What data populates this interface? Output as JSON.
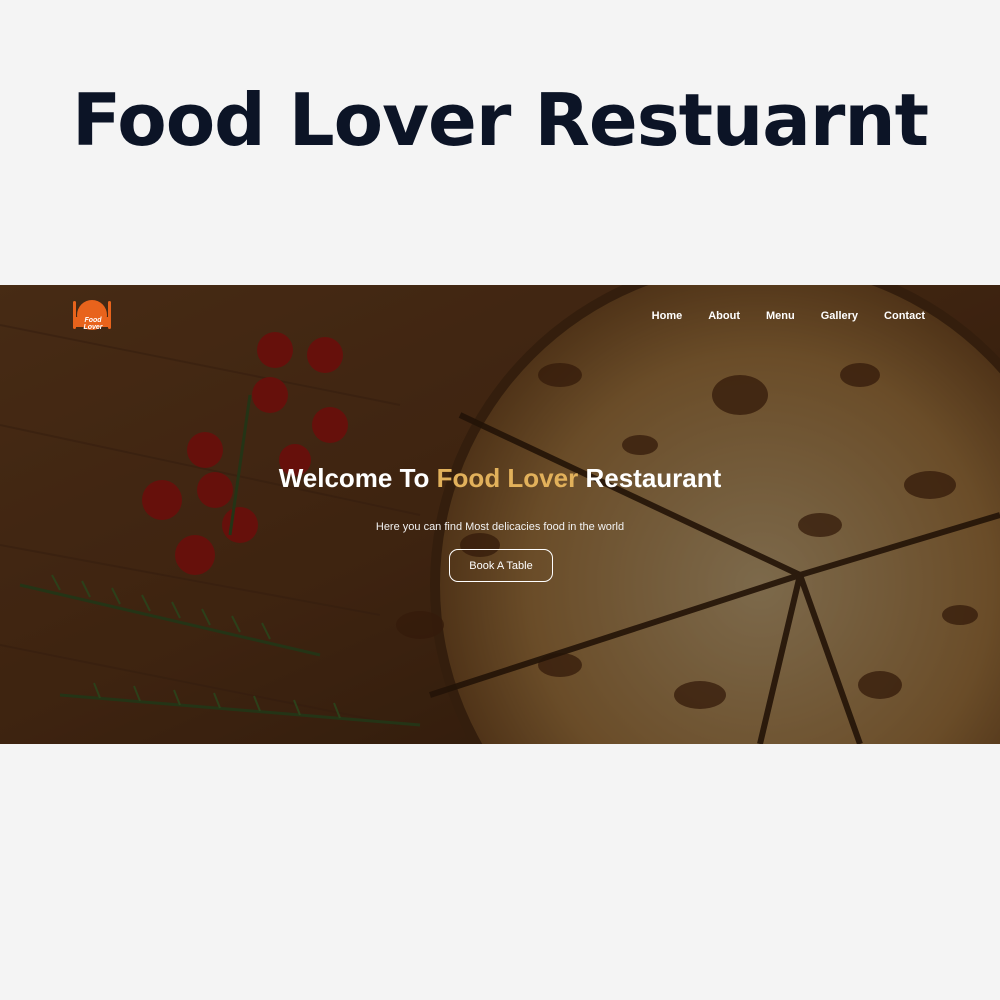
{
  "page": {
    "title": "Food Lover Restuarnt"
  },
  "hero": {
    "logo_text": "Food Lover",
    "logo_icon": "plate-fork-knife-icon",
    "nav": [
      {
        "label": "Home"
      },
      {
        "label": "About"
      },
      {
        "label": "Menu"
      },
      {
        "label": "Gallery"
      },
      {
        "label": "Contact"
      }
    ],
    "welcome_prefix": "Welcome To ",
    "welcome_accent": "Food Lover",
    "welcome_suffix": " Restaurant",
    "subtitle": "Here you can find Most delicacies food in the world",
    "cta_label": "Book A Table"
  },
  "colors": {
    "title": "#0c1426",
    "accent": "#e2b15b",
    "logo": "#e8631c",
    "background": "#f4f4f4"
  }
}
